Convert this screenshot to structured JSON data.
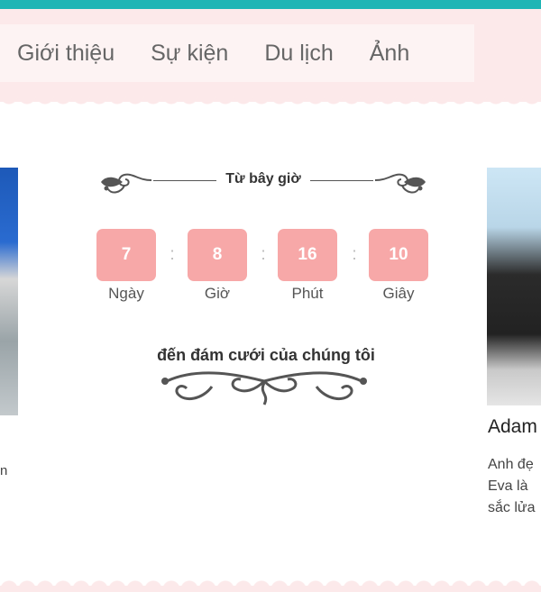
{
  "nav": {
    "items": [
      "Giới thiệu",
      "Sự kiện",
      "Du lịch",
      "Ảnh"
    ]
  },
  "countdown": {
    "heading": "Từ bây giờ",
    "values": {
      "days": "7",
      "hours": "8",
      "minutes": "16",
      "seconds": "10"
    },
    "units": {
      "days": "Ngày",
      "hours": "Giờ",
      "minutes": "Phút",
      "seconds": "Giây"
    },
    "separator": ":",
    "subtitle": "đến đám cưới của chúng tôi"
  },
  "left_card": {
    "fragment": "n"
  },
  "right_card": {
    "name": "Adam",
    "desc_lines": [
      "Anh đẹ",
      "Eva là",
      "sắc lửa"
    ]
  },
  "colors": {
    "accent_teal": "#1fb5b5",
    "band_pink": "#fce9ea",
    "box_pink": "#f7a8a8"
  },
  "icons": [
    "flourish-ornament-icon",
    "scroll-divider-icon"
  ]
}
